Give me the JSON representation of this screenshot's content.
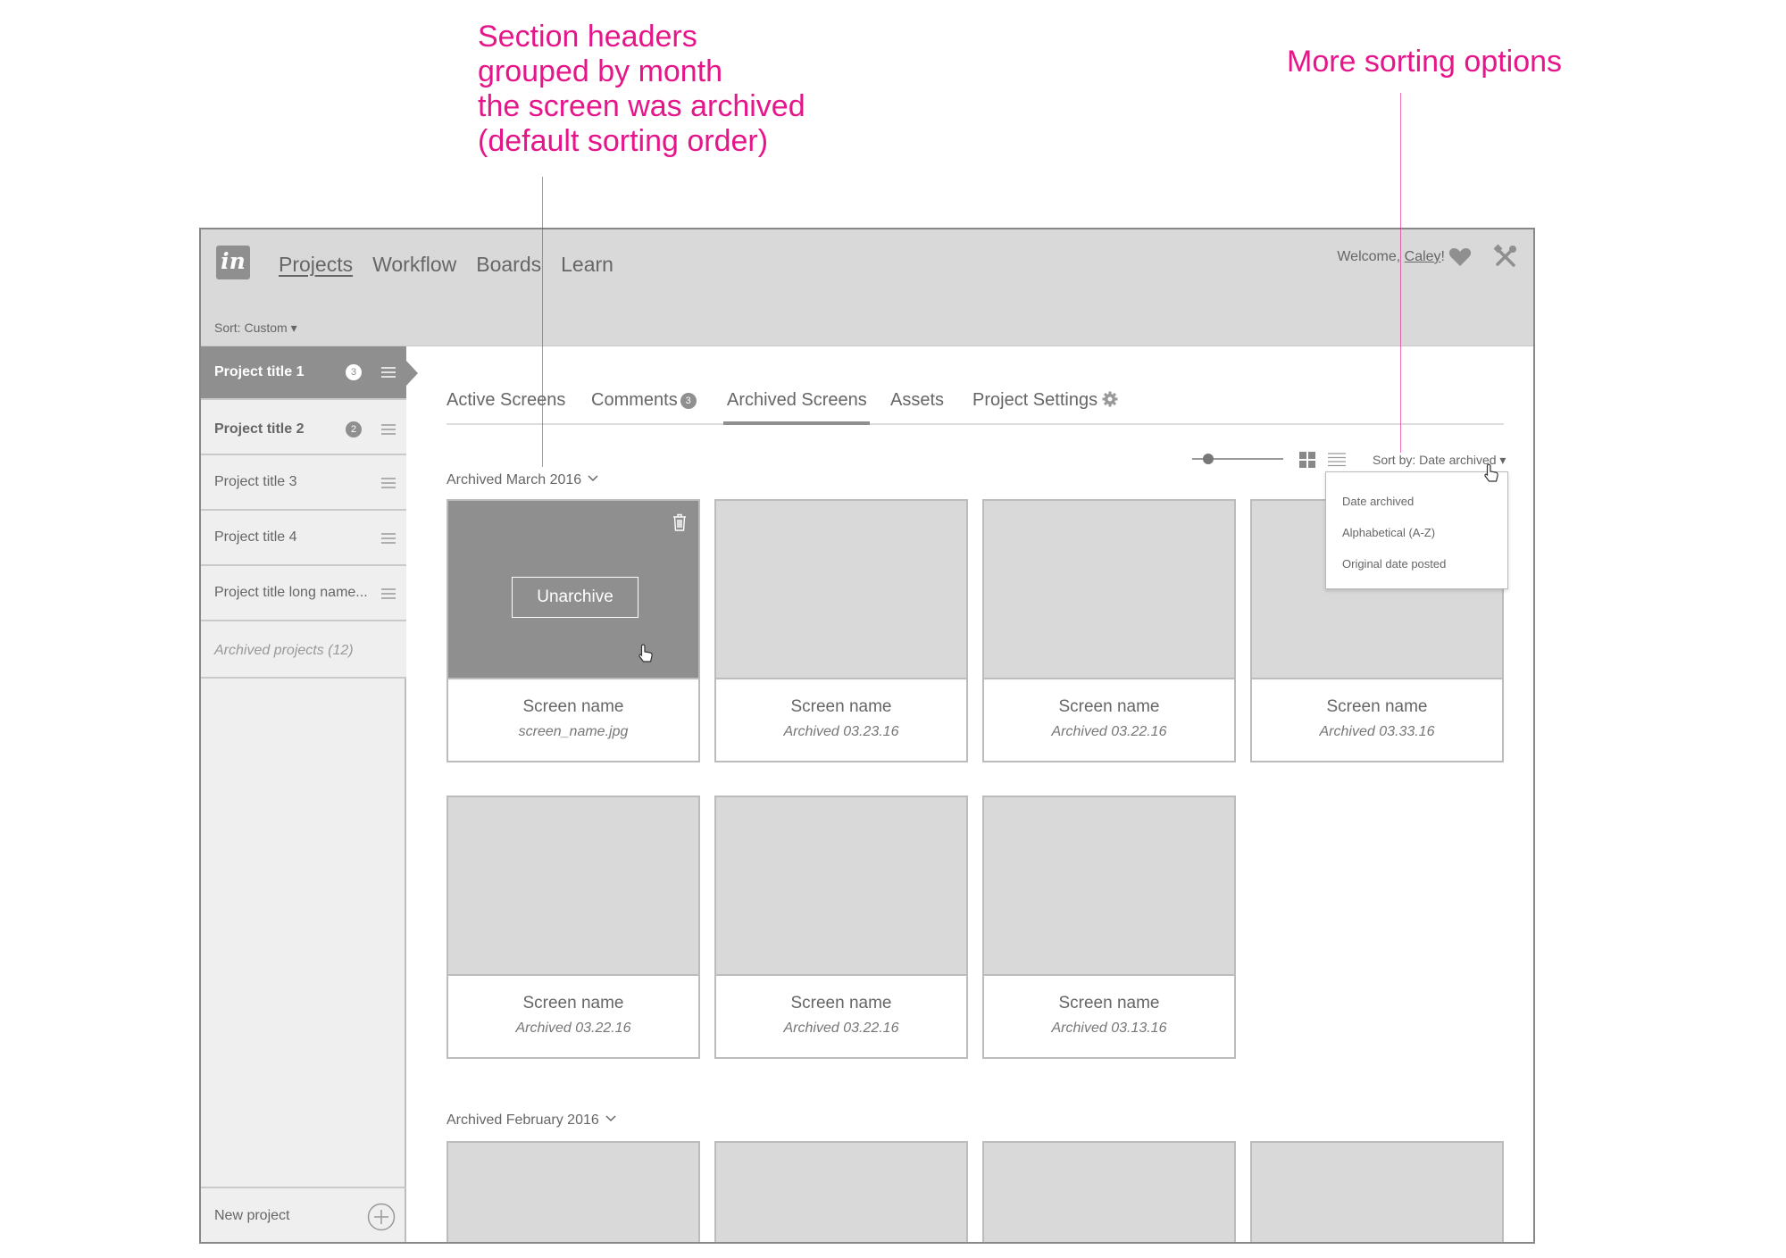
{
  "annotations": {
    "sections": "Section headers\ngrouped by month\nthe screen was archived\n(default sorting order)",
    "sorting": "More sorting options"
  },
  "colors": {
    "annotation": "#e5158a",
    "topbar_bg": "#d9d9d9",
    "active_gray": "#8f8f8f",
    "sidebar_bg": "#efefef",
    "thumb_bg": "#d9d9d9"
  },
  "logo": {
    "text": "in"
  },
  "nav": {
    "items": [
      {
        "label": "Projects",
        "active": true
      },
      {
        "label": "Workflow"
      },
      {
        "label": "Boards"
      },
      {
        "label": "Learn"
      }
    ]
  },
  "header": {
    "welcome_prefix": "Welcome, ",
    "user_name": "Caley",
    "welcome_suffix": "!",
    "icons": [
      "heart-icon",
      "tools-icon"
    ]
  },
  "sidebar": {
    "sort_label": "Sort: Custom ▾",
    "projects": [
      {
        "name": "Project title 1",
        "badge": "3",
        "selected": true
      },
      {
        "name": "Project title 2",
        "badge": "2"
      },
      {
        "name": "Project title 3"
      },
      {
        "name": "Project title 4"
      },
      {
        "name": "Project title long name..."
      }
    ],
    "archived_label": "Archived projects (12)",
    "new_project_label": "New project"
  },
  "tabs": {
    "active_screens": "Active Screens",
    "comments": "Comments",
    "comments_count": "3",
    "archived_screens": "Archived Screens",
    "assets": "Assets",
    "project_settings": "Project Settings",
    "selected": "Archived Screens"
  },
  "toolbar": {
    "zoom_level": 0.13,
    "sort_label": "Sort by: Date archived ▾",
    "view_icons": [
      "grid-view-icon",
      "list-view-icon"
    ]
  },
  "sort_dropdown": {
    "options": [
      "Date archived",
      "Alphabetical (A-Z)",
      "Original date posted"
    ]
  },
  "sections": [
    {
      "header": "Archived March 2016",
      "cards": [
        {
          "name": "Screen name",
          "sub": "screen_name.jpg",
          "hovered": true,
          "action": "Unarchive"
        },
        {
          "name": "Screen name",
          "sub": "Archived 03.23.16"
        },
        {
          "name": "Screen name",
          "sub": "Archived 03.22.16"
        },
        {
          "name": "Screen name",
          "sub": "Archived 03.33.16"
        },
        {
          "name": "Screen name",
          "sub": "Archived 03.22.16"
        },
        {
          "name": "Screen name",
          "sub": "Archived 03.22.16"
        },
        {
          "name": "Screen name",
          "sub": "Archived 03.13.16"
        }
      ]
    },
    {
      "header": "Archived February 2016",
      "cards": [
        {},
        {},
        {},
        {}
      ]
    }
  ]
}
